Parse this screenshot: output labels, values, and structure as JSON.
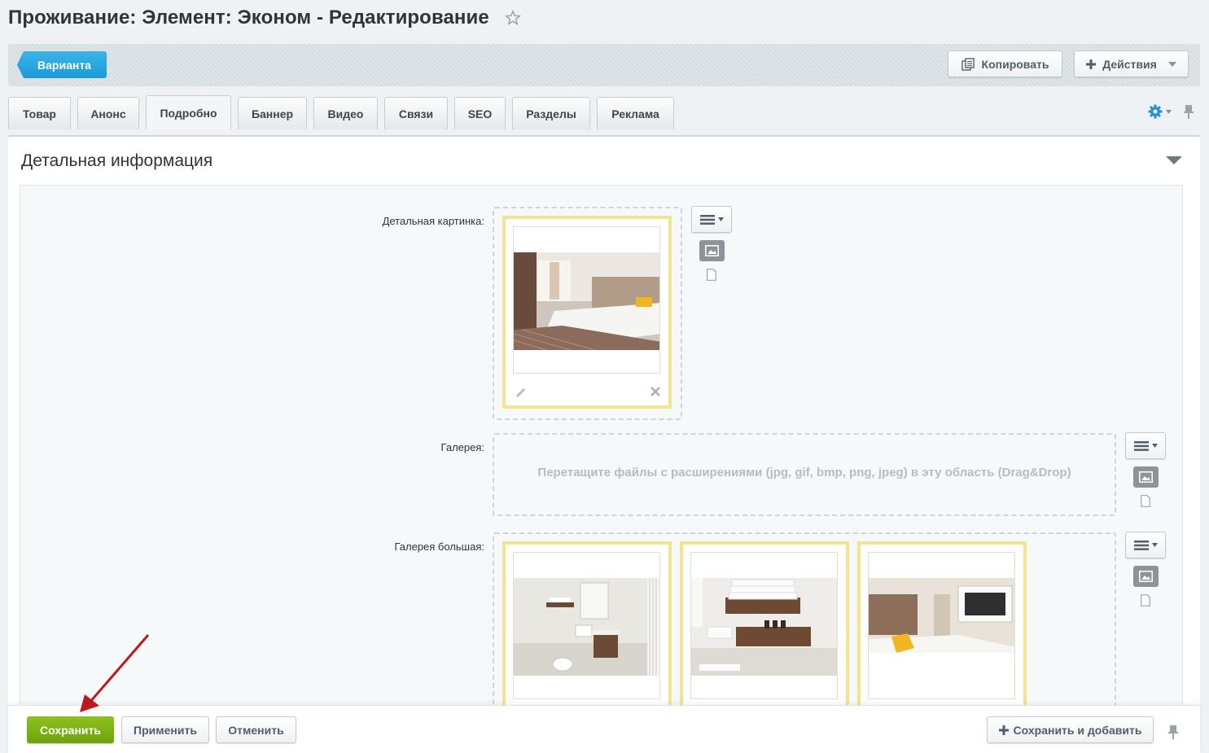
{
  "page": {
    "title": "Проживание: Элемент: Эконом - Редактирование"
  },
  "toolbar": {
    "variant_label": "Варианта",
    "copy_label": "Копировать",
    "actions_label": "Действия"
  },
  "tabs": [
    {
      "label": "Товар"
    },
    {
      "label": "Анонс"
    },
    {
      "label": "Подробно",
      "active": true
    },
    {
      "label": "Баннер"
    },
    {
      "label": "Видео"
    },
    {
      "label": "Связи"
    },
    {
      "label": "SEO"
    },
    {
      "label": "Разделы"
    },
    {
      "label": "Реклама"
    }
  ],
  "section": {
    "title": "Детальная информация",
    "fields": {
      "detail_picture_label": "Детальная картинка:",
      "gallery_label": "Галерея:",
      "gallery_drop_text": "Перетащите файлы с расширениями (jpg, gif, bmp, png, jpeg) в эту область (Drag&Drop)",
      "gallery_big_label": "Галерея большая:"
    }
  },
  "footer": {
    "save_label": "Сохранить",
    "apply_label": "Применить",
    "cancel_label": "Отменить",
    "save_add_label": "Сохранить и добавить"
  },
  "colors": {
    "accent_blue": "#1b9bd8",
    "save_green": "#7ab317",
    "card_border": "#f7e38a",
    "arrow_red": "#c0171c"
  }
}
